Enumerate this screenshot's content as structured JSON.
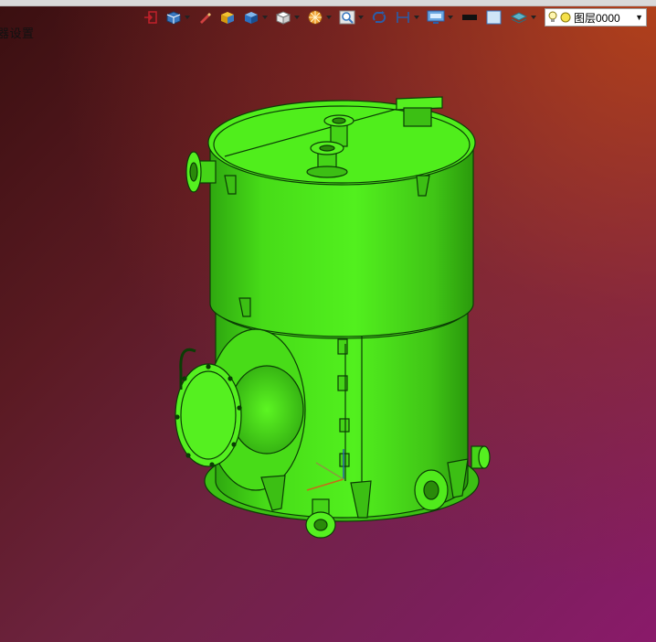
{
  "corner_label": "器设置",
  "toolbar": {
    "buttons": [
      {
        "icon": "exit-icon",
        "has_menu": false
      },
      {
        "icon": "view-cube-icon",
        "has_menu": true
      },
      {
        "icon": "pen-icon",
        "has_menu": false
      },
      {
        "icon": "shaded-box-icon",
        "has_menu": false
      },
      {
        "icon": "blue-box-icon",
        "has_menu": true
      },
      {
        "icon": "white-box-icon",
        "has_menu": true
      },
      {
        "icon": "render-sphere-icon",
        "has_menu": true
      },
      {
        "icon": "zoom-icon",
        "has_menu": true
      },
      {
        "icon": "rotate-icon",
        "has_menu": false
      },
      {
        "icon": "measure-icon",
        "has_menu": true
      },
      {
        "icon": "display-icon",
        "has_menu": true
      },
      {
        "icon": "black-rect-icon",
        "has_menu": false
      },
      {
        "icon": "light-blue-square-icon",
        "has_menu": false
      },
      {
        "icon": "layers-icon",
        "has_menu": true
      }
    ],
    "layer_select": {
      "value": "图层0000"
    }
  },
  "colors": {
    "model_green": "#4ee81c",
    "model_outline": "#0b3d05",
    "bg_dark": "#3a0f10",
    "bg_orange": "#be4614",
    "bg_magenta": "#8a1a6a"
  }
}
